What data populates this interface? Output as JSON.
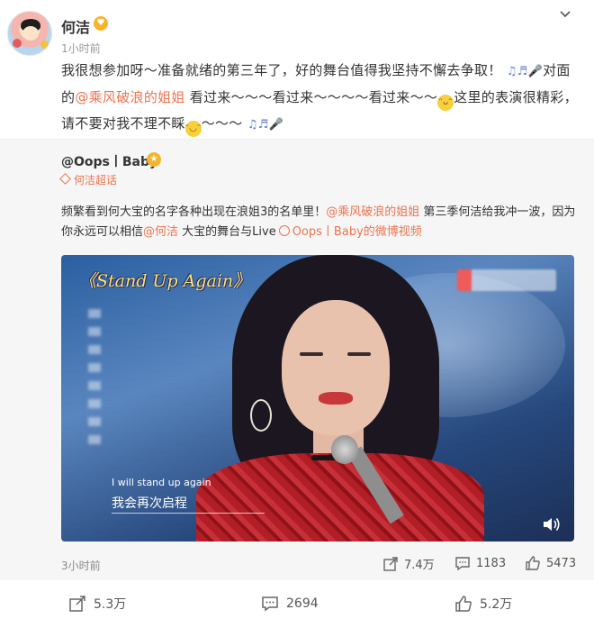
{
  "post": {
    "username": "何洁",
    "time": "1小时前",
    "text": {
      "part1": "我很想参加呀～准备就绪的第三年了，好的舞台值得我坚持不懈去争取！",
      "part2": "对面的",
      "mention": "@乘风破浪的姐姐",
      "part3": " 看过来～～～看过来～～～～看过来～～",
      "part4": "这里的表演很精彩，请不要对我不理不睬",
      "part5": "～～～"
    },
    "icons": {
      "music_notes": "♫",
      "notes": "♬",
      "mic": "🎤",
      "grin": "😁",
      "laugh": "😂"
    }
  },
  "repost": {
    "username": "@Oops丨Baby",
    "supertopic": "何洁超话",
    "text": {
      "part1": "频繁看到何大宝的名字各种出现在浪姐3的名单里！",
      "mention1": "@乘风破浪的姐姐",
      "part2": " 第三季何洁给我冲一波，因为你永远可以相信",
      "mention2": "@何洁",
      "part3": " 大宝的舞台与Live",
      "video_link": "Oops丨Baby的微博视频"
    },
    "video": {
      "title": "《Stand Up Again》",
      "subtitle_en": "I will stand up again",
      "subtitle_cn": "我会再次启程"
    },
    "time": "3小时前",
    "stats": {
      "reposts": "7.4万",
      "comments": "1183",
      "likes": "5473"
    }
  },
  "footer": {
    "reposts": "5.3万",
    "comments": "2694",
    "likes": "5.2万"
  },
  "colors": {
    "mention": "#eb7350",
    "badge": "#f6b42c",
    "repost_bg": "#f6f6f6"
  }
}
